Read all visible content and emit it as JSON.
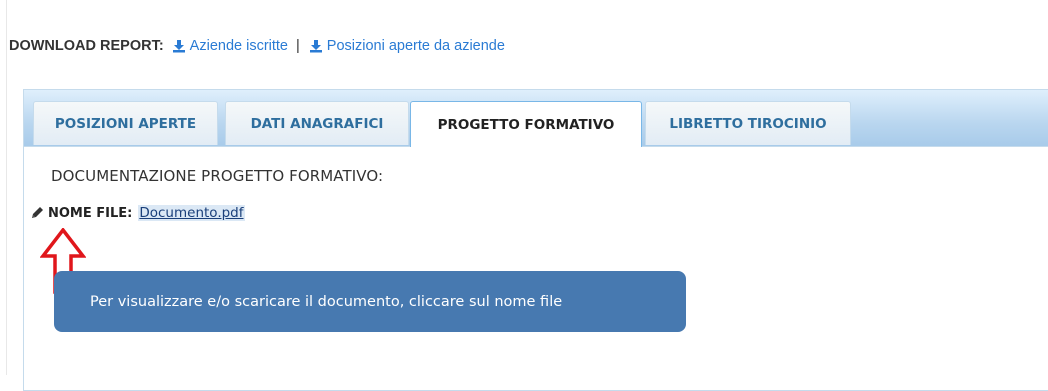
{
  "download": {
    "label": "DOWNLOAD REPORT:",
    "links": [
      "Aziende iscritte",
      "Posizioni aperte da aziende"
    ],
    "separator": "|",
    "icon": "download-icon"
  },
  "tabs": [
    {
      "label": "POSIZIONI APERTE",
      "active": false
    },
    {
      "label": "DATI ANAGRAFICI",
      "active": false
    },
    {
      "label": "PROGETTO FORMATIVO",
      "active": true
    },
    {
      "label": "LIBRETTO TIROCINIO",
      "active": false
    }
  ],
  "content": {
    "title": "DOCUMENTAZIONE PROGETTO FORMATIVO:",
    "file_label": "NOME FILE:",
    "file_name": "Documento.pdf",
    "edit_icon": "pencil-icon"
  },
  "annotation": {
    "arrow_icon": "up-arrow-icon",
    "arrow_color": "#e0161b",
    "tooltip_text": "Per visualizzare e/o scaricare il documento, cliccare sul nome file",
    "tooltip_color": "#4779b0"
  }
}
